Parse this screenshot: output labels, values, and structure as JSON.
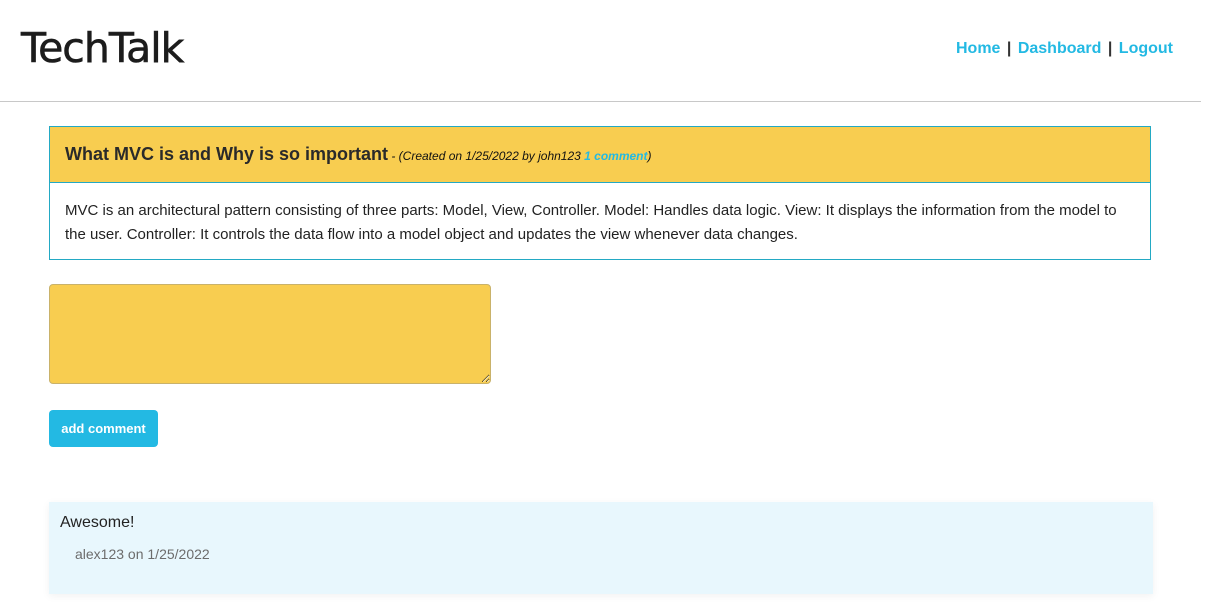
{
  "header": {
    "logo": "TechTalk",
    "nav": [
      {
        "label": "Home"
      },
      {
        "label": "Dashboard"
      },
      {
        "label": "Logout"
      }
    ],
    "separator": "|"
  },
  "post": {
    "title": "What MVC is and Why is so important",
    "meta_prefix": " - (Created on 1/25/2022 by john123 ",
    "comment_link": "1 comment",
    "meta_suffix": ")",
    "body": "MVC is an architectural pattern consisting of three parts: Model, View, Controller. Model: Handles data logic. View: It displays the information from the model to the user. Controller: It controls the data flow into a model object and updates the view whenever data changes."
  },
  "comment_form": {
    "value": "",
    "button_label": "add comment"
  },
  "comments": [
    {
      "text": "Awesome!",
      "meta": "alex123 on 1/25/2022"
    }
  ],
  "colors": {
    "accent": "#23b9e3",
    "post_header_bg": "#f8cd50",
    "post_border": "#23a9c4",
    "comment_bg": "#e8f7fd"
  }
}
